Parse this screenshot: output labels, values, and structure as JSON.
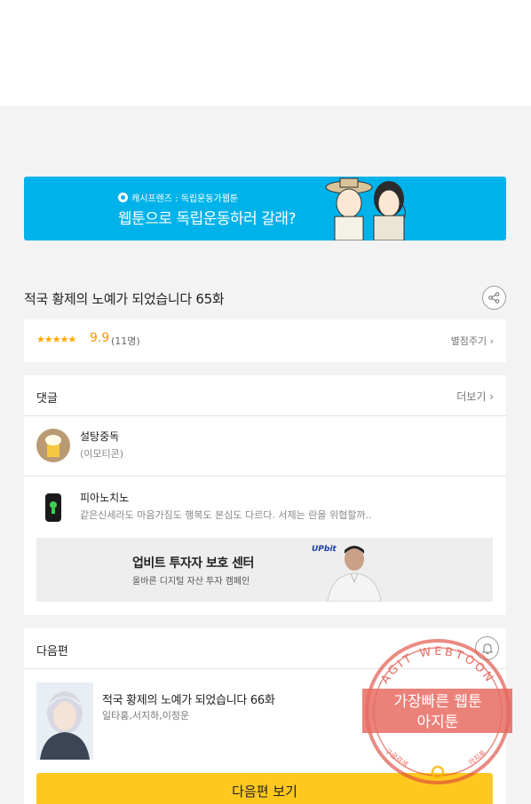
{
  "banner": {
    "sub": "캐시프렌즈 : 독립운동가웹툰",
    "headline": "웹툰으로 독립운동하러 갈래?"
  },
  "episode": {
    "title": "적국 황제의 노예가 되었습니다 65화"
  },
  "rating": {
    "stars": "★★★★★",
    "score": "9.9",
    "count": "(11명)",
    "link": "별점주기 ›"
  },
  "comments": {
    "label": "댓글",
    "more": "더보기 ›",
    "items": [
      {
        "name": "설탕중독",
        "text": "(이모티콘)"
      },
      {
        "name": "피아노치노",
        "text": "같은신세라도 마음가짐도 행복도 본심도 다르다. 서제는 란을 위협할까.."
      }
    ]
  },
  "ad": {
    "title": "업비트 투자자 보호 센터",
    "sub": "올바른 디지털 자산 투자 캠페인",
    "logo": "UPbit"
  },
  "next": {
    "label": "다음편",
    "title": "적국 황제의 노예가 되었습니다 66화",
    "authors": "일타홍,서지하,이정운",
    "button": "다음편 보기"
  },
  "watermark": {
    "arc": "AGIT WEBTOON",
    "line1": "가장빠른 웹툰",
    "line2": "아지툰",
    "bottom_left": "구글검색",
    "bottom_right": "아지툰"
  },
  "colors": {
    "banner_bg": "#00b2ea",
    "accent_yellow": "#ffc81e",
    "star": "#ffa800",
    "watermark": "#e0483c"
  }
}
